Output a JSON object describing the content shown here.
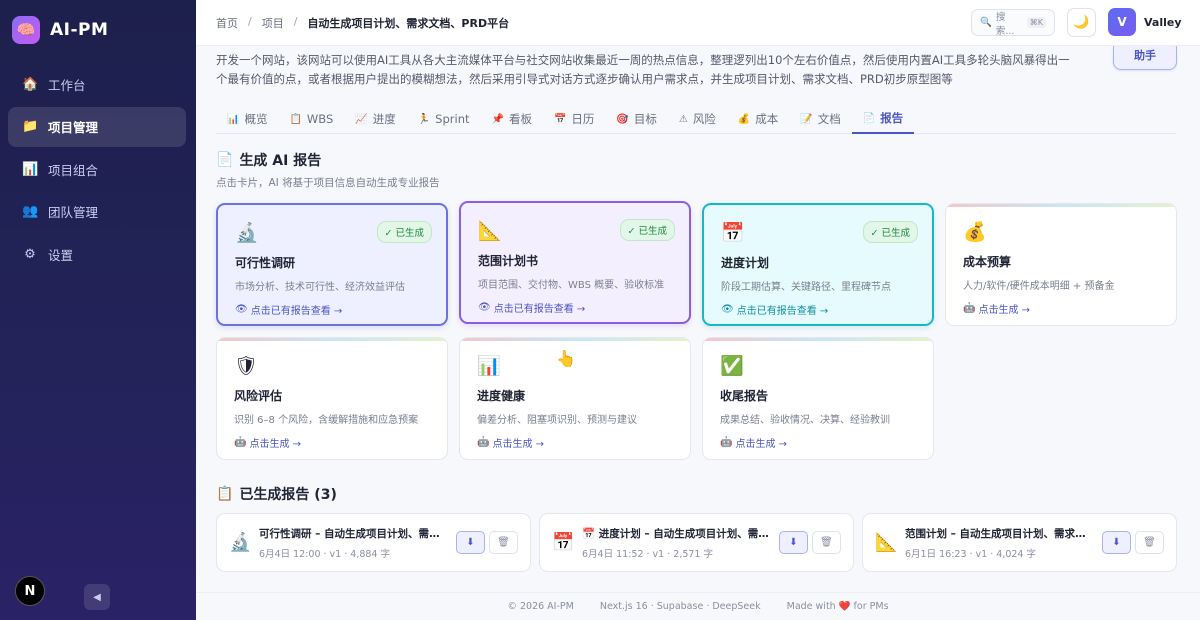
{
  "sidebar": {
    "brand": "AI-PM",
    "items": [
      {
        "icon": "🏠",
        "label": "工作台"
      },
      {
        "icon": "📁",
        "label": "项目管理"
      },
      {
        "icon": "📊",
        "label": "项目组合"
      },
      {
        "icon": "👥",
        "label": "团队管理"
      },
      {
        "icon": "⚙",
        "label": "设置"
      }
    ],
    "next_badge": "N",
    "collapse_glyph": "◀"
  },
  "header": {
    "breadcrumb": [
      "首页",
      "项目",
      "自动生成项目计划、需求文档、PRD平台"
    ],
    "search_placeholder": "搜索...",
    "search_shortcut": "⌘K",
    "theme_glyph": "🌙",
    "avatar_letter": "V",
    "username": "Valley"
  },
  "project": {
    "description": "开发一个网站，该网站可以使用AI工具从各大主流媒体平台与社交网站收集最近一周的热点信息，整理逻列出10个左右价值点，然后使用内置AI工具多轮头脑风暴得出一个最有价值的点，或者根据用户提出的模糊想法，然后采用引导式对话方式逐步确认用户需求点，并生成项目计划、需求文档、PRD初步原型图等",
    "assistant_label": "助手"
  },
  "tabs": [
    {
      "icon": "📊",
      "label": "概览"
    },
    {
      "icon": "📋",
      "label": "WBS"
    },
    {
      "icon": "📈",
      "label": "进度"
    },
    {
      "icon": "🏃",
      "label": "Sprint"
    },
    {
      "icon": "📌",
      "label": "看板"
    },
    {
      "icon": "📅",
      "label": "日历"
    },
    {
      "icon": "🎯",
      "label": "目标"
    },
    {
      "icon": "⚠",
      "label": "风险"
    },
    {
      "icon": "💰",
      "label": "成本"
    },
    {
      "icon": "📝",
      "label": "文档"
    },
    {
      "icon": "📄",
      "label": "报告"
    }
  ],
  "generate": {
    "icon": "📄",
    "title": "生成 AI 报告",
    "subtitle": "点击卡片，AI 将基于项目信息自动生成专业报告",
    "done_badge": "✓ 已生成",
    "cards": [
      {
        "icon": "🔬",
        "title": "可行性调研",
        "desc": "市场分析、技术可行性、经济效益评估",
        "action_icon": "👁",
        "action": "点击已有报告查看 →",
        "done": true
      },
      {
        "icon": "📐",
        "title": "范围计划书",
        "desc": "项目范围、交付物、WBS 概要、验收标准",
        "action_icon": "👁",
        "action": "点击已有报告查看 →",
        "done": true
      },
      {
        "icon": "📅",
        "title": "进度计划",
        "desc": "阶段工期估算、关键路径、里程碑节点",
        "action_icon": "👁",
        "action": "点击已有报告查看 →",
        "done": true
      },
      {
        "icon": "💰",
        "title": "成本预算",
        "desc": "人力/软件/硬件成本明细 + 预备金",
        "action_icon": "🤖",
        "action": "点击生成 →",
        "done": false
      },
      {
        "icon": "🛡",
        "title": "风险评估",
        "desc": "识别 6–8 个风险，含缓解措施和应急预案",
        "action_icon": "🤖",
        "action": "点击生成 →",
        "done": false
      },
      {
        "icon": "📊",
        "title": "进度健康",
        "desc": "偏差分析、阻塞项识别、预测与建议",
        "action_icon": "🤖",
        "action": "点击生成 →",
        "done": false
      },
      {
        "icon": "✅",
        "title": "收尾报告",
        "desc": "成果总结、验收情况、决算、经验教训",
        "action_icon": "🤖",
        "action": "点击生成 →",
        "done": false
      }
    ]
  },
  "reports": {
    "icon": "📋",
    "title": "已生成报告 (3)",
    "download_glyph": "⬇",
    "delete_glyph": "🗑",
    "items": [
      {
        "icon": "🔬",
        "name": "可行性调研 – 自动生成项目计划、需求文档、PRD平台",
        "meta": "6月4日 12:00 · v1 · 4,884 字"
      },
      {
        "icon": "📅",
        "name": "📅 进度计划 – 自动生成项目计划、需求文档、PRD平台",
        "meta": "6月4日 11:52 · v1 · 2,571 字"
      },
      {
        "icon": "📐",
        "name": "范围计划 – 自动生成项目计划、需求文档、PRD平台",
        "meta": "6月1日 16:23 · v1 · 4,024 字"
      }
    ]
  },
  "footer": {
    "copyright": "© 2026 AI-PM",
    "stack": "Next.js 16 · Supabase · DeepSeek",
    "made_with": "Made with ❤️ for PMs"
  },
  "cursor_glyph": "👆"
}
